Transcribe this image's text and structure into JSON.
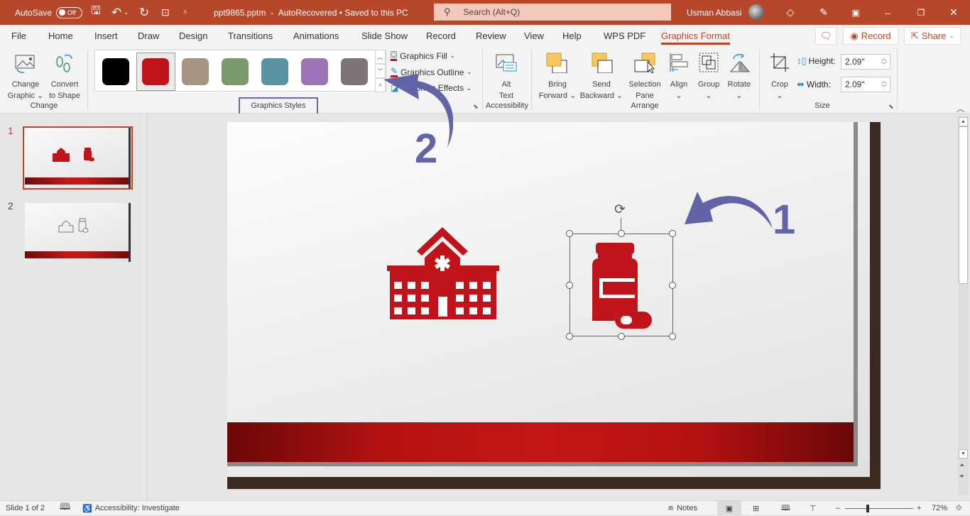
{
  "titlebar": {
    "autosave_label": "AutoSave",
    "autosave_state": "Off",
    "filename": "ppt9865.pptm",
    "separator": "-",
    "status": "AutoRecovered • Saved to this PC",
    "search_placeholder": "Search (Alt+Q)",
    "user_name": "Usman Abbasi",
    "bg_color": "#b7472a"
  },
  "menu": {
    "tabs": [
      {
        "label": "File"
      },
      {
        "label": "Home"
      },
      {
        "label": "Insert"
      },
      {
        "label": "Draw"
      },
      {
        "label": "Design"
      },
      {
        "label": "Transitions"
      },
      {
        "label": "Animations"
      },
      {
        "label": "Slide Show"
      },
      {
        "label": "Record"
      },
      {
        "label": "Review"
      },
      {
        "label": "View"
      },
      {
        "label": "Help"
      },
      {
        "label": "WPS PDF"
      },
      {
        "label": "Graphics Format",
        "active": true
      }
    ],
    "record_button": "Record",
    "share_button": "Share"
  },
  "ribbon": {
    "change_group": {
      "label": "Change",
      "change_graphic": [
        "Change",
        "Graphic"
      ],
      "convert_to_shape": [
        "Convert",
        "to Shape"
      ]
    },
    "styles_group": {
      "label": "Graphics Styles",
      "swatches": [
        {
          "name": "black",
          "color": "#000000"
        },
        {
          "name": "red",
          "color": "#c0141a",
          "selected": true
        },
        {
          "name": "tan",
          "color": "#a69580"
        },
        {
          "name": "green",
          "color": "#7a9c6c"
        },
        {
          "name": "teal",
          "color": "#5a94a4"
        },
        {
          "name": "purple",
          "color": "#9b74b8"
        },
        {
          "name": "mauve",
          "color": "#7f7279"
        }
      ],
      "fill": "Graphics Fill",
      "outline": "Graphics Outline",
      "effects": "Graphics Effects"
    },
    "accessibility_group": {
      "label": "Accessibility",
      "alt_text": [
        "Alt",
        "Text"
      ]
    },
    "arrange_group": {
      "label": "Arrange",
      "bring_forward": [
        "Bring",
        "Forward"
      ],
      "send_backward": [
        "Send",
        "Backward"
      ],
      "selection_pane": [
        "Selection",
        "Pane"
      ],
      "align": "Align",
      "group": "Group",
      "rotate": "Rotate"
    },
    "size_group": {
      "label": "Size",
      "crop": "Crop",
      "height_label": "Height:",
      "height_value": "2.09\"",
      "width_label": "Width:",
      "width_value": "2.09\""
    }
  },
  "slides_pane": {
    "slides": [
      {
        "number": "1",
        "selected": true
      },
      {
        "number": "2",
        "selected": false
      }
    ]
  },
  "annotations": {
    "step1": "1",
    "step2": "2",
    "color": "#6264a7"
  },
  "statusbar": {
    "slide_info": "Slide 1 of 2",
    "accessibility": "Accessibility: Investigate",
    "notes": "Notes",
    "zoom": "72%"
  }
}
